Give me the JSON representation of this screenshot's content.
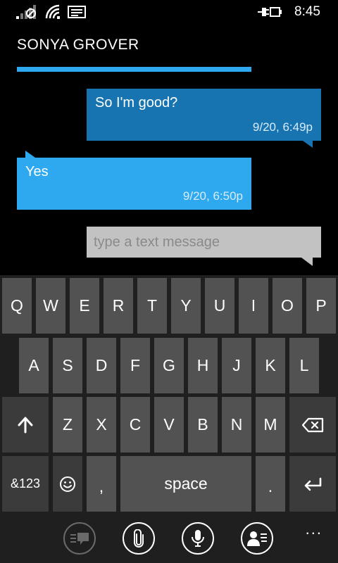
{
  "status_bar": {
    "time": "8:45",
    "icons": [
      "signal-no-sim-icon",
      "wifi-icon",
      "message-icon",
      "battery-charging-icon"
    ]
  },
  "conversation": {
    "contact_name": "SONYA GROVER",
    "messages": [
      {
        "direction": "sent",
        "text": "So I'm good?",
        "timestamp": "9/20, 6:49p"
      },
      {
        "direction": "received",
        "text": "Yes",
        "timestamp": "9/20, 6:50p"
      }
    ]
  },
  "composer": {
    "placeholder": "type a text message",
    "value": ""
  },
  "keyboard": {
    "row1": [
      "Q",
      "W",
      "E",
      "R",
      "T",
      "Y",
      "U",
      "I",
      "O",
      "P"
    ],
    "row2": [
      "A",
      "S",
      "D",
      "F",
      "G",
      "H",
      "J",
      "K",
      "L"
    ],
    "row3_letters": [
      "Z",
      "X",
      "C",
      "V",
      "B",
      "N",
      "M"
    ],
    "row4": {
      "symbols": "&123",
      "comma": ",",
      "space": "space",
      "period": "."
    }
  },
  "app_bar": {
    "buttons": [
      "switch-conversation-icon",
      "attach-icon",
      "microphone-icon",
      "contact-card-icon"
    ],
    "more": "..."
  },
  "colors": {
    "accent": "#2ea9ef",
    "sent_bubble": "#1774b0",
    "key": "#525252",
    "keyboard_bg": "#1f1f1f"
  }
}
